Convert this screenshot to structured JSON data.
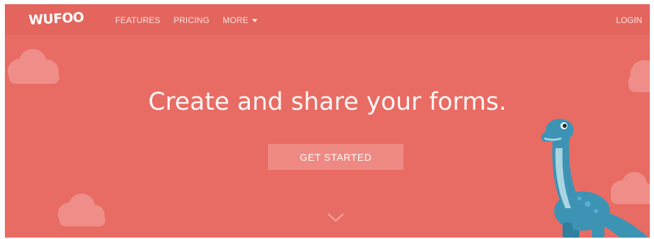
{
  "header": {
    "logo_text": "WUFOO",
    "nav": [
      {
        "label": "FEATURES"
      },
      {
        "label": "PRICING"
      },
      {
        "label": "MORE",
        "icon": "caret-down-icon"
      }
    ],
    "login_label": "LOGIN"
  },
  "hero": {
    "headline": "Create and share your forms.",
    "cta_label": "GET STARTED",
    "scroll_icon": "chevron-down-icon",
    "mascot": "dinosaur-illustration"
  },
  "colors": {
    "background": "#e86c64",
    "topbar": "#e4655d",
    "button": "#ee8a83",
    "cloud": "#ef8e88",
    "dino_body": "#3d93b4"
  }
}
